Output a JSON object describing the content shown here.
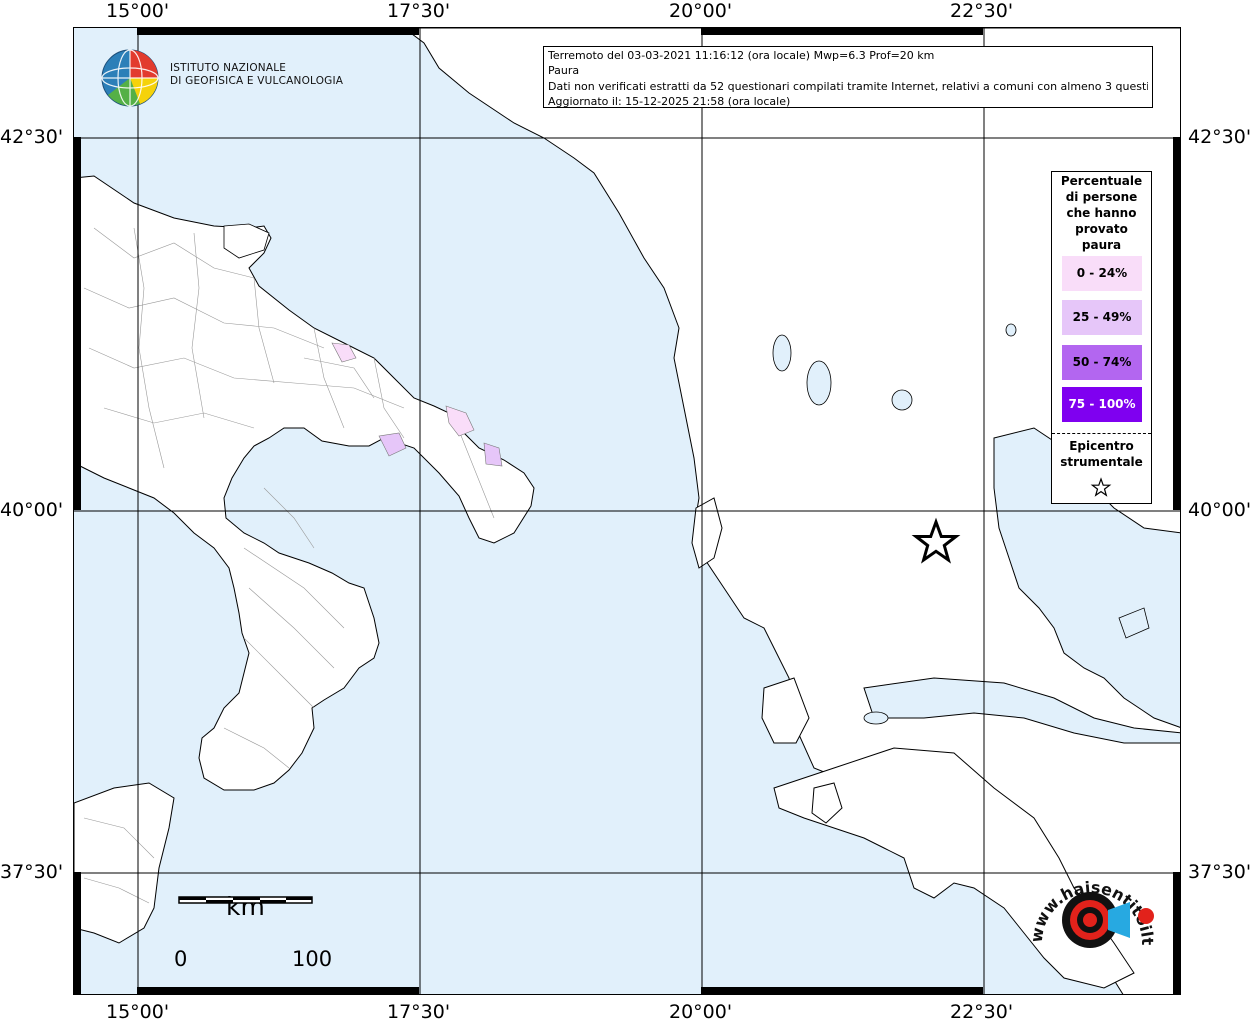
{
  "axes": {
    "lon_labels": [
      "15°00'",
      "17°30'",
      "20°00'",
      "22°30'"
    ],
    "lat_labels": [
      "42°30'",
      "40°00'",
      "37°30'"
    ]
  },
  "info": {
    "line1": "Terremoto del 03-03-2021 11:16:12 (ora locale) Mwp=6.3 Prof=20 km",
    "line2": "Paura",
    "line3": "Dati non verificati estratti da 52 questionari compilati tramite Internet, relativi a comuni con almeno 3 questionari.",
    "line4": "Aggiornato il: 15-12-2025 21:58 (ora locale)"
  },
  "logo": {
    "line1": "ISTITUTO NAZIONALE",
    "line2": "DI GEOFISICA E VULCANOLOGIA"
  },
  "legend": {
    "title_lines": [
      "Percentuale",
      "di persone",
      "che hanno",
      "provato",
      "paura"
    ],
    "items": [
      {
        "label": "0 - 24%",
        "color": "#f9ddf9",
        "text_color": "#000000"
      },
      {
        "label": "25 - 49%",
        "color": "#e6c6f9",
        "text_color": "#000000"
      },
      {
        "label": "50 - 74%",
        "color": "#b366f0",
        "text_color": "#000000"
      },
      {
        "label": "75 - 100%",
        "color": "#7f00f0",
        "text_color": "#ffffff"
      }
    ],
    "epicenter_lines": [
      "Epicentro",
      "strumentale"
    ]
  },
  "scale": {
    "unit": "km",
    "start": "0",
    "end": "100"
  },
  "brand": {
    "text": "www.haisentitoilterremoto.it",
    "red": "#e2221b",
    "blue": "#27a9e1"
  },
  "colors": {
    "sea": "#e1f0fb",
    "land": "#ffffff",
    "border": "#000000"
  },
  "epicenter": {
    "lon": 21.85,
    "lat": 39.78
  }
}
